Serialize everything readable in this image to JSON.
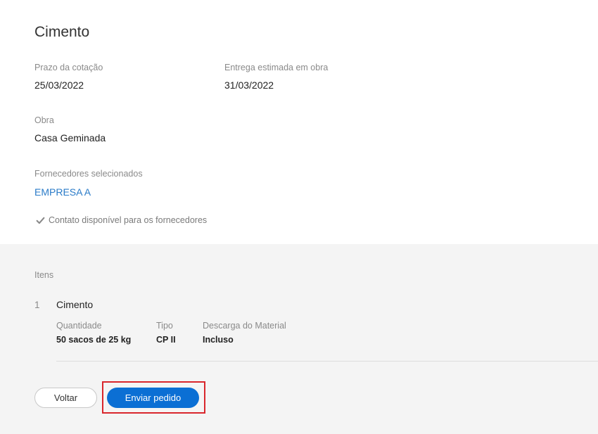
{
  "header": {
    "title": "Cimento"
  },
  "quote": {
    "deadline_label": "Prazo da cotação",
    "deadline_value": "25/03/2022",
    "delivery_label": "Entrega estimada em obra",
    "delivery_value": "31/03/2022",
    "site_label": "Obra",
    "site_value": "Casa Geminada",
    "suppliers_label": "Fornecedores selecionados",
    "supplier_name": "EMPRESA A",
    "contact_text": "Contato disponível para os fornecedores"
  },
  "items": {
    "section_label": "Itens",
    "list": [
      {
        "index": "1",
        "name": "Cimento",
        "quantity_label": "Quantidade",
        "quantity_value": "50 sacos de 25 kg",
        "type_label": "Tipo",
        "type_value": "CP II",
        "unload_label": "Descarga do Material",
        "unload_value": "Incluso"
      }
    ]
  },
  "actions": {
    "back_label": "Voltar",
    "send_label": "Enviar pedido"
  },
  "colors": {
    "link": "#2a7bc8",
    "primary_button": "#0b6fd4",
    "highlight": "#d9262c"
  },
  "icons": {
    "contact": "check-icon"
  }
}
